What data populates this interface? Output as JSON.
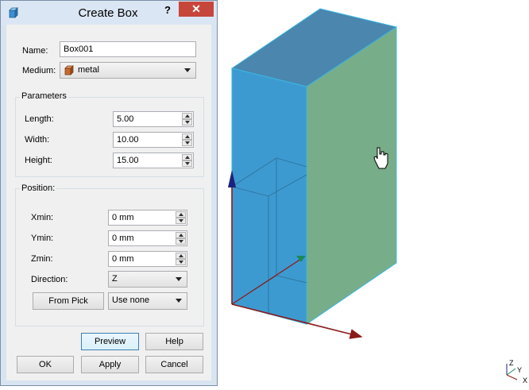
{
  "dialog": {
    "title": "Create Box",
    "help_label": "?",
    "close_label": "✕",
    "name_label": "Name:",
    "name_value": "Box001",
    "medium_label": "Medium:",
    "medium_value": "metal",
    "parameters": {
      "title": "Parameters",
      "length_label": "Length:",
      "length_value": "5.00",
      "width_label": "Width:",
      "width_value": "10.00",
      "height_label": "Height:",
      "height_value": "15.00"
    },
    "position": {
      "title": "Position:",
      "xmin_label": "Xmin:",
      "xmin_value": "0 mm",
      "ymin_label": "Ymin:",
      "ymin_value": "0 mm",
      "zmin_label": "Zmin:",
      "zmin_value": "0 mm",
      "direction_label": "Direction:",
      "direction_value": "Z",
      "from_pick_label": "From Pick",
      "use_none_value": "Use none"
    },
    "buttons": {
      "preview": "Preview",
      "help": "Help",
      "ok": "OK",
      "apply": "Apply",
      "cancel": "Cancel"
    }
  },
  "viewport": {
    "axis_labels": {
      "z": "Z",
      "y": "Y",
      "x": "X"
    },
    "colors": {
      "front_face": "#3d9ad0",
      "side_face": "#77ad88",
      "top_face": "#4a86ad",
      "edge": "#3cb7e6",
      "axis_red": "#8b1a1a",
      "axis_blue": "#1a237e",
      "axis_green": "#1a8a5a"
    }
  }
}
